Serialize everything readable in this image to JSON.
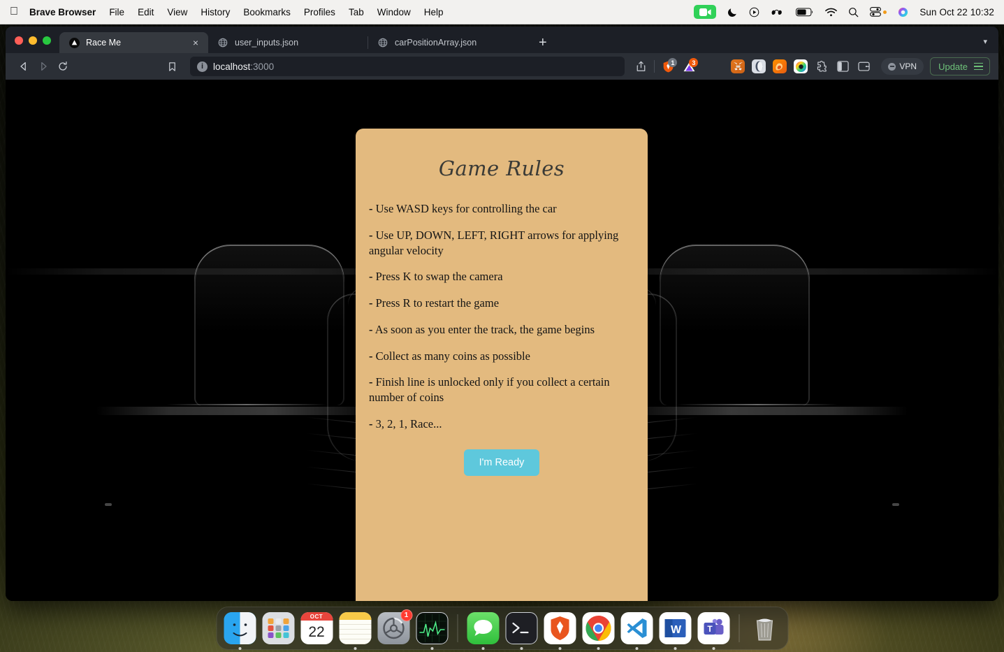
{
  "menubar": {
    "apple_icon": "apple-icon",
    "app_name": "Brave Browser",
    "items": [
      "File",
      "Edit",
      "View",
      "History",
      "Bookmarks",
      "Profiles",
      "Tab",
      "Window",
      "Help"
    ],
    "status_icons": [
      "screen-record-icon",
      "do-not-disturb-icon",
      "now-playing-icon",
      "headphones-icon",
      "battery-icon",
      "wifi-icon",
      "search-icon",
      "control-center-icon",
      "siri-icon"
    ],
    "clock": "Sun Oct 22  10:32"
  },
  "browser": {
    "tabs": [
      {
        "title": "Race Me",
        "favicon": "race-triangle-icon",
        "active": true,
        "close_label": "×"
      },
      {
        "title": "user_inputs.json",
        "favicon": "globe-icon",
        "active": false
      },
      {
        "title": "carPositionArray.json",
        "favicon": "globe-icon",
        "active": false
      }
    ],
    "new_tab_label": "+",
    "tab_list_chevron": "▾",
    "toolbar": {
      "back_icon": "back-arrow-icon",
      "forward_icon": "forward-arrow-icon",
      "reload_icon": "reload-icon",
      "bookmark_icon": "bookmark-icon",
      "site_info_icon": "info-icon",
      "url_host": "localhost",
      "url_port": ":3000",
      "share_icon": "share-icon",
      "shields_icon": "brave-shields-icon",
      "shields_badge": "1",
      "vercel_icon": "vercel-triangle-icon",
      "vercel_badge": "3",
      "extensions": [
        "metamask-icon",
        "brave-rewards-icon",
        "firefox-relay-icon",
        "color-wheel-icon",
        "puzzle-icon",
        "sidebar-icon",
        "wallet-icon"
      ],
      "vpn_label": "VPN",
      "update_label": "Update",
      "menu_icon": "hamburger-menu-icon"
    }
  },
  "page": {
    "title": "Game Rules",
    "rules": [
      "Use WASD keys for controlling the car",
      "Use UP, DOWN, LEFT, RIGHT arrows for applying angular velocity",
      "Press K to swap the camera",
      "Press R to restart the game",
      "As soon as you enter the track, the game begins",
      "Collect as many coins as possible",
      "Finish line is unlocked only if you collect a certain number of coins",
      "3, 2, 1, Race..."
    ],
    "bullet": "-",
    "ready_button": "I'm Ready",
    "colors": {
      "panel": "#e3ba7f",
      "button": "#5ec8dc",
      "button_text": "#ffffff",
      "text": "#141414"
    }
  },
  "dock": {
    "items": [
      {
        "name": "finder",
        "label": "Finder",
        "running": true
      },
      {
        "name": "launchpad",
        "label": "Launchpad",
        "running": false
      },
      {
        "name": "calendar",
        "label": "Calendar",
        "month": "OCT",
        "day": "22",
        "running": false
      },
      {
        "name": "notes",
        "label": "Notes",
        "running": true
      },
      {
        "name": "system-settings",
        "label": "System Settings",
        "badge": "1",
        "running": false
      },
      {
        "name": "activity-monitor",
        "label": "Activity Monitor",
        "running": true
      },
      {
        "name": "messages",
        "label": "Messages",
        "running": true
      },
      {
        "name": "terminal",
        "label": "Terminal",
        "running": true
      },
      {
        "name": "brave-browser",
        "label": "Brave Browser",
        "running": true
      },
      {
        "name": "google-chrome",
        "label": "Google Chrome",
        "running": true
      },
      {
        "name": "visual-studio-code",
        "label": "Visual Studio Code",
        "running": true
      },
      {
        "name": "microsoft-word",
        "label": "Microsoft Word",
        "running": true
      },
      {
        "name": "microsoft-teams",
        "label": "Microsoft Teams",
        "running": true
      },
      {
        "name": "trash",
        "label": "Trash",
        "running": false
      }
    ]
  }
}
